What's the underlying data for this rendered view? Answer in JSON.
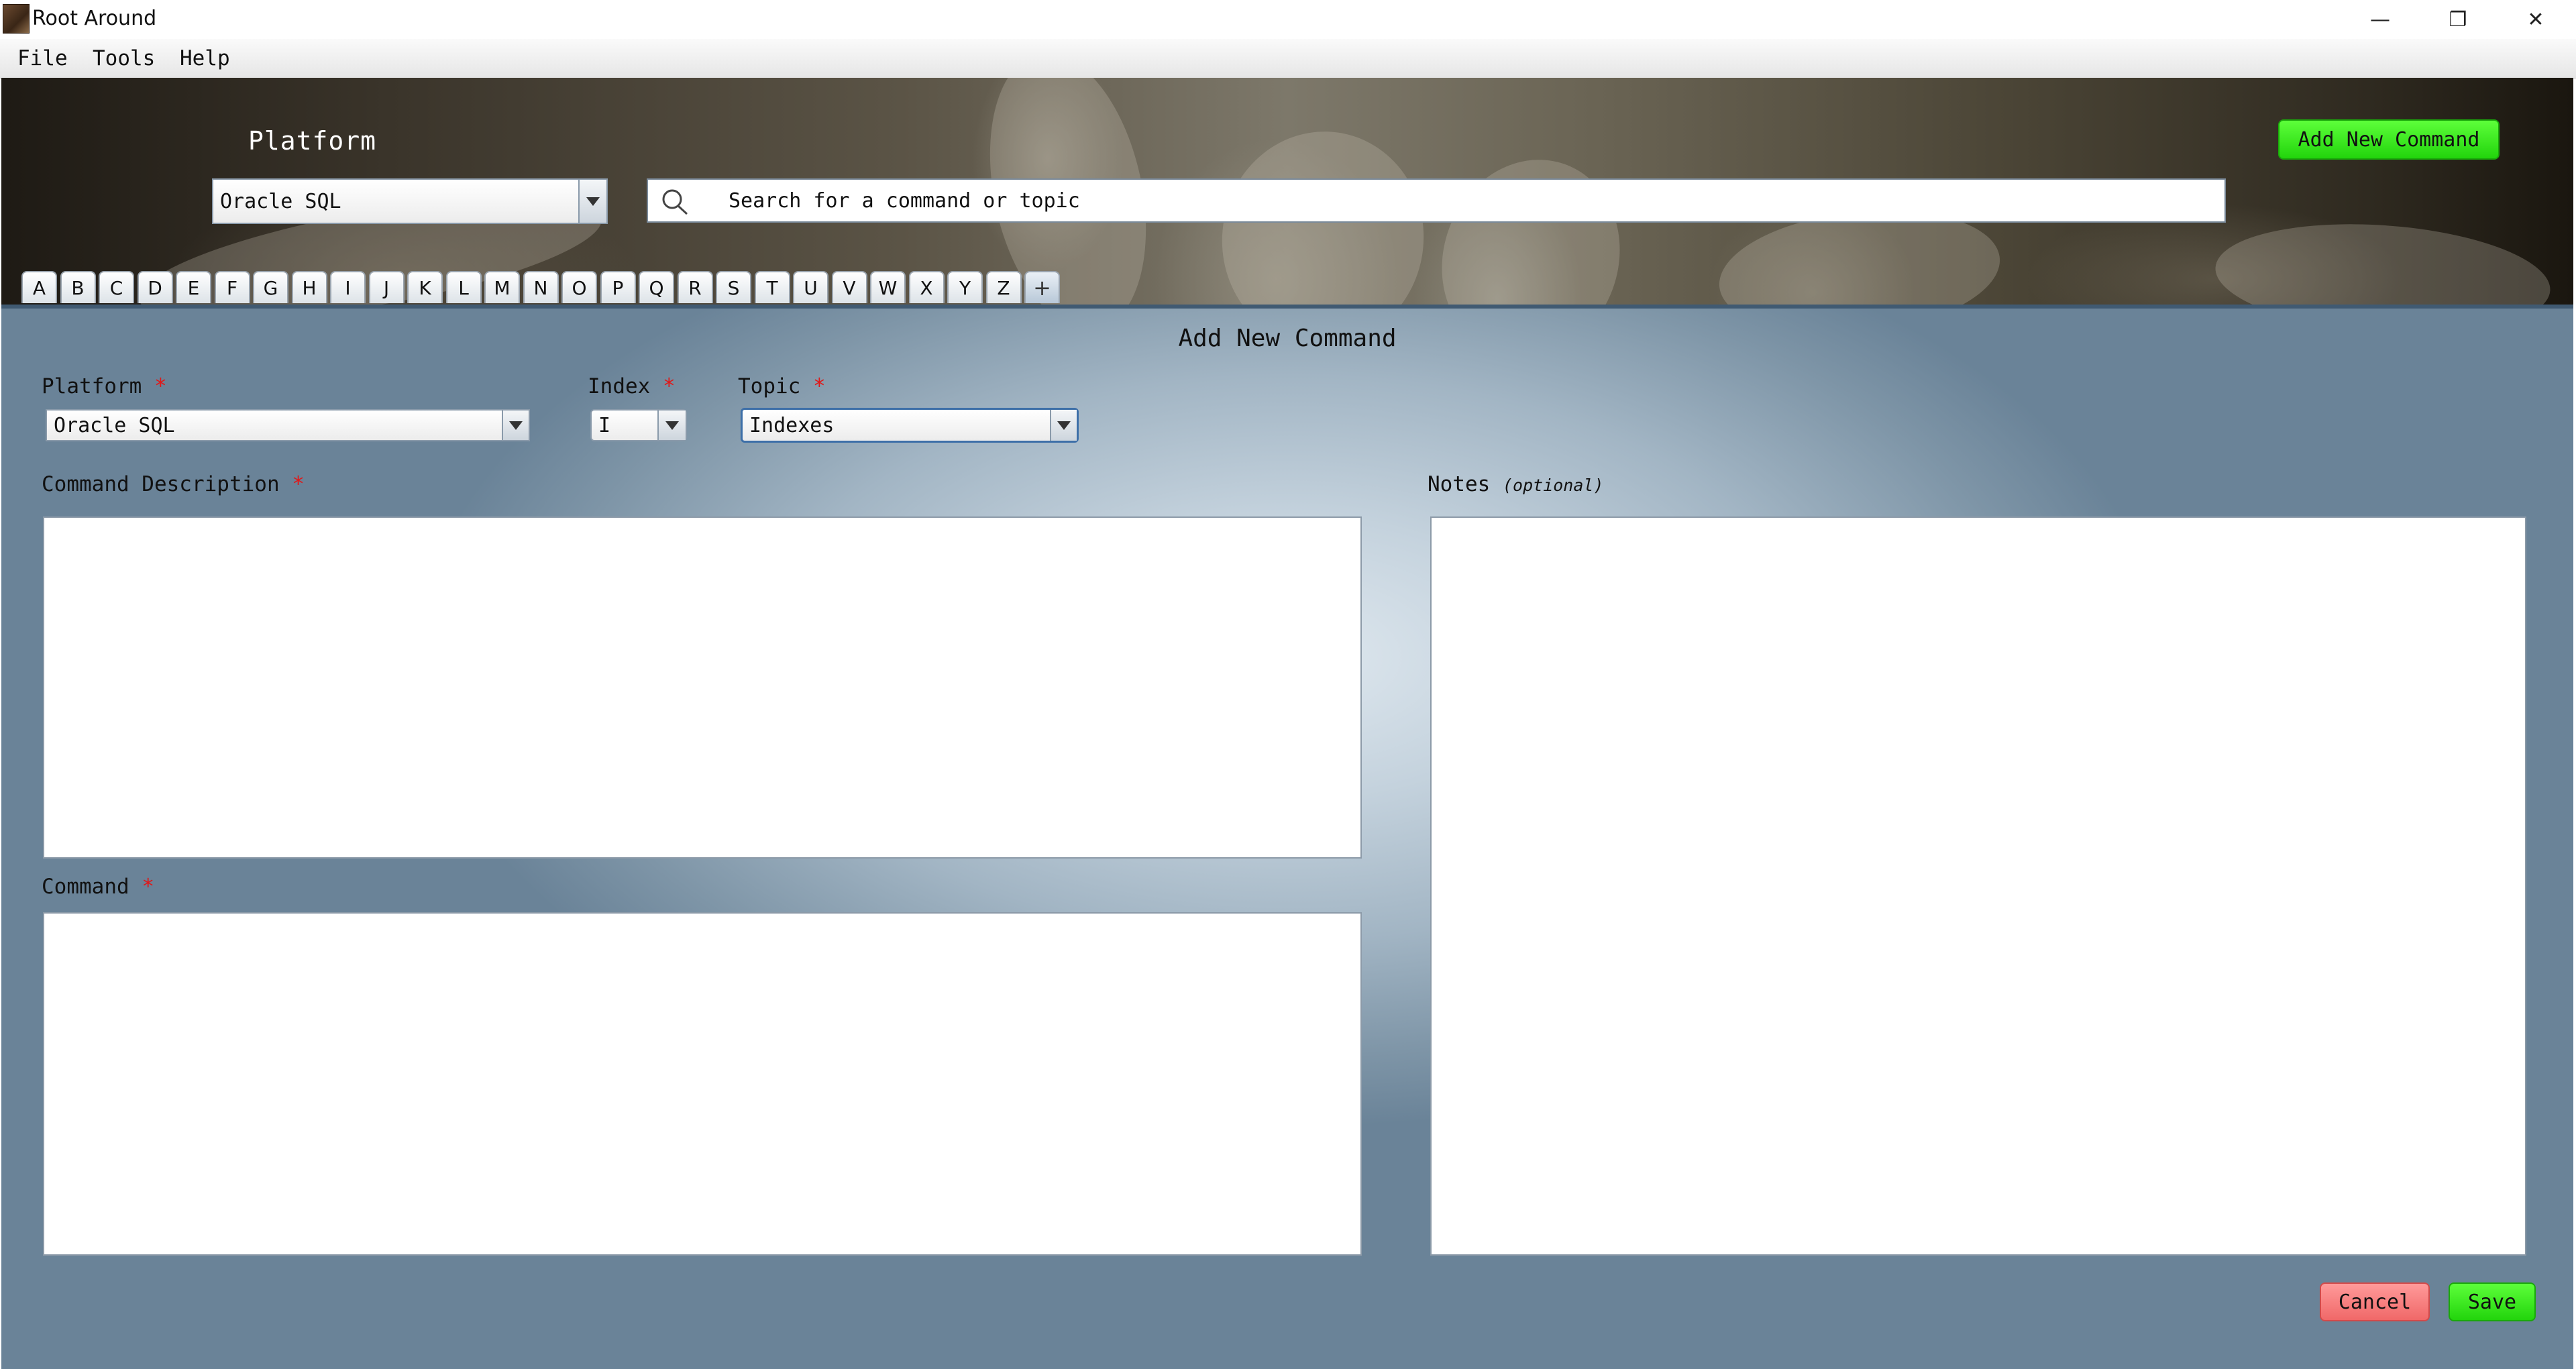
{
  "window": {
    "title": "Root Around",
    "minimize_glyph": "—",
    "maximize_glyph": "❐",
    "close_glyph": "✕"
  },
  "menu": [
    "File",
    "Tools",
    "Help"
  ],
  "header": {
    "platform_label": "Platform",
    "platform_value": "Oracle SQL",
    "search_placeholder": "Search for a command or topic",
    "add_button": "Add New Command"
  },
  "letter_tabs": [
    "A",
    "B",
    "C",
    "D",
    "E",
    "F",
    "G",
    "H",
    "I",
    "J",
    "K",
    "L",
    "M",
    "N",
    "O",
    "P",
    "Q",
    "R",
    "S",
    "T",
    "U",
    "V",
    "W",
    "X",
    "Y",
    "Z",
    "+"
  ],
  "form": {
    "title": "Add New Command",
    "platform_label": "Platform",
    "platform_value": "Oracle SQL",
    "index_label": "Index",
    "index_value": "I",
    "topic_label": "Topic",
    "topic_value": "Indexes",
    "required_mark": "*",
    "description_label": "Command Description",
    "description_value": "",
    "command_label": "Command",
    "command_value": "",
    "notes_label": "Notes",
    "notes_hint": "(optional)",
    "notes_value": "",
    "cancel_button": "Cancel",
    "save_button": "Save"
  },
  "colors": {
    "accent_green": "#22d40c",
    "cancel_red": "#f06868",
    "required_red": "#e01818",
    "panel_blue": "#7e95a7"
  }
}
